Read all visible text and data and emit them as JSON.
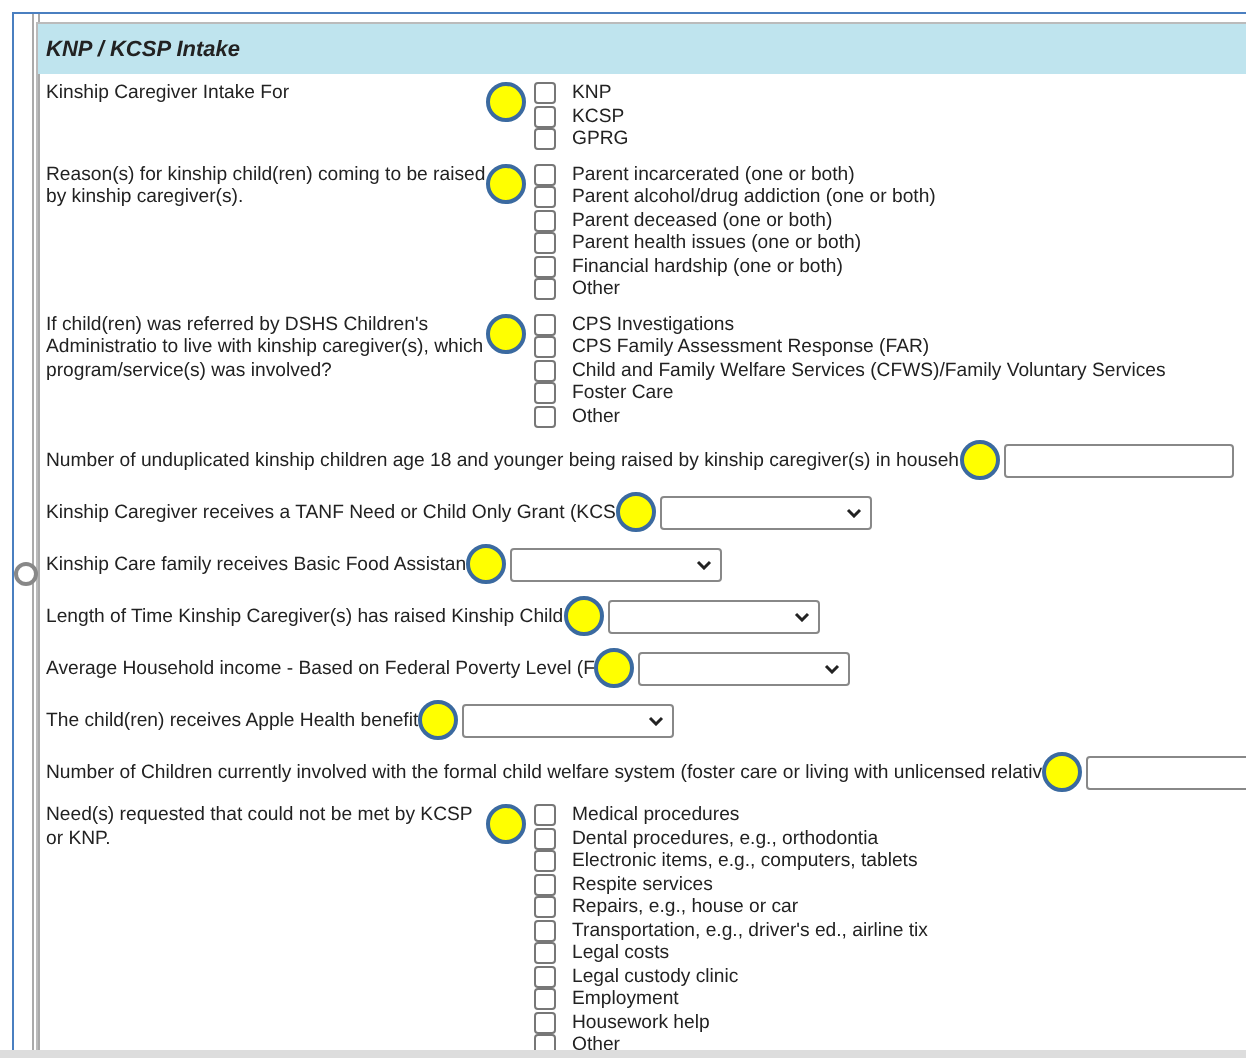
{
  "section": {
    "title": "KNP / KCSP Intake"
  },
  "fields": [
    {
      "kind": "checkboxes",
      "label": "Kinship Caregiver Intake For",
      "marked": true,
      "options": [
        {
          "label": "KNP",
          "checked": false
        },
        {
          "label": "KCSP",
          "checked": false
        },
        {
          "label": "GPRG",
          "checked": false
        }
      ]
    },
    {
      "kind": "checkboxes",
      "label": "Reason(s) for kinship child(ren) coming to be raised by kinship caregiver(s).",
      "marked": true,
      "options": [
        {
          "label": "Parent incarcerated (one or both)",
          "checked": false
        },
        {
          "label": "Parent alcohol/drug addiction (one or both)",
          "checked": false
        },
        {
          "label": "Parent deceased (one or both)",
          "checked": false
        },
        {
          "label": "Parent health issues (one or both)",
          "checked": false
        },
        {
          "label": "Financial hardship (one or both)",
          "checked": false
        },
        {
          "label": "Other",
          "checked": false
        }
      ]
    },
    {
      "kind": "checkboxes",
      "label": "If child(ren) was referred by DSHS Children's Administratio to live with kinship caregiver(s), which program/service(s) was involved?",
      "marked": true,
      "options": [
        {
          "label": "CPS Investigations",
          "checked": false
        },
        {
          "label": "CPS Family Assessment Response (FAR)",
          "checked": false
        },
        {
          "label": "Child and Family Welfare Services (CFWS)/Family Voluntary Services",
          "checked": false
        },
        {
          "label": "Foster Care",
          "checked": false
        },
        {
          "label": "Other",
          "checked": false
        }
      ]
    },
    {
      "kind": "text",
      "label": "Number of unduplicated kinship children age 18 and younger being raised by kinship caregiver(s) in househ",
      "marked": true
    },
    {
      "kind": "select",
      "label": "Kinship Caregiver receives a TANF Need or Child Only Grant (KCS",
      "marked": true
    },
    {
      "kind": "select",
      "label": "Kinship Care family receives Basic Food Assistan",
      "marked": true
    },
    {
      "kind": "select",
      "label": "Length of Time Kinship Caregiver(s) has raised Kinship Child",
      "marked": true
    },
    {
      "kind": "select",
      "label": "Average Household income - Based on Federal Poverty Level (F",
      "marked": true
    },
    {
      "kind": "select",
      "label": "The child(ren) receives Apple Health benefit",
      "marked": true
    },
    {
      "kind": "text",
      "label": "Number of Children currently involved with the formal child welfare system (foster care or living with unlicensed relativ",
      "marked": true
    },
    {
      "kind": "checkboxes",
      "label": "Need(s) requested that could not be met by KCSP or KNP.",
      "marked": true,
      "options": [
        {
          "label": "Medical procedures",
          "checked": false
        },
        {
          "label": "Dental procedures, e.g., orthodontia",
          "checked": false
        },
        {
          "label": "Electronic items, e.g., computers, tablets",
          "checked": false
        },
        {
          "label": "Respite services",
          "checked": false
        },
        {
          "label": "Repairs, e.g., house or car",
          "checked": false
        },
        {
          "label": "Transportation, e.g., driver's ed., airline tix",
          "checked": false
        },
        {
          "label": "Legal costs",
          "checked": false
        },
        {
          "label": "Legal custody clinic",
          "checked": false
        },
        {
          "label": "Employment",
          "checked": false
        },
        {
          "label": "Housework help",
          "checked": false
        },
        {
          "label": "Other",
          "checked": false
        }
      ]
    }
  ]
}
